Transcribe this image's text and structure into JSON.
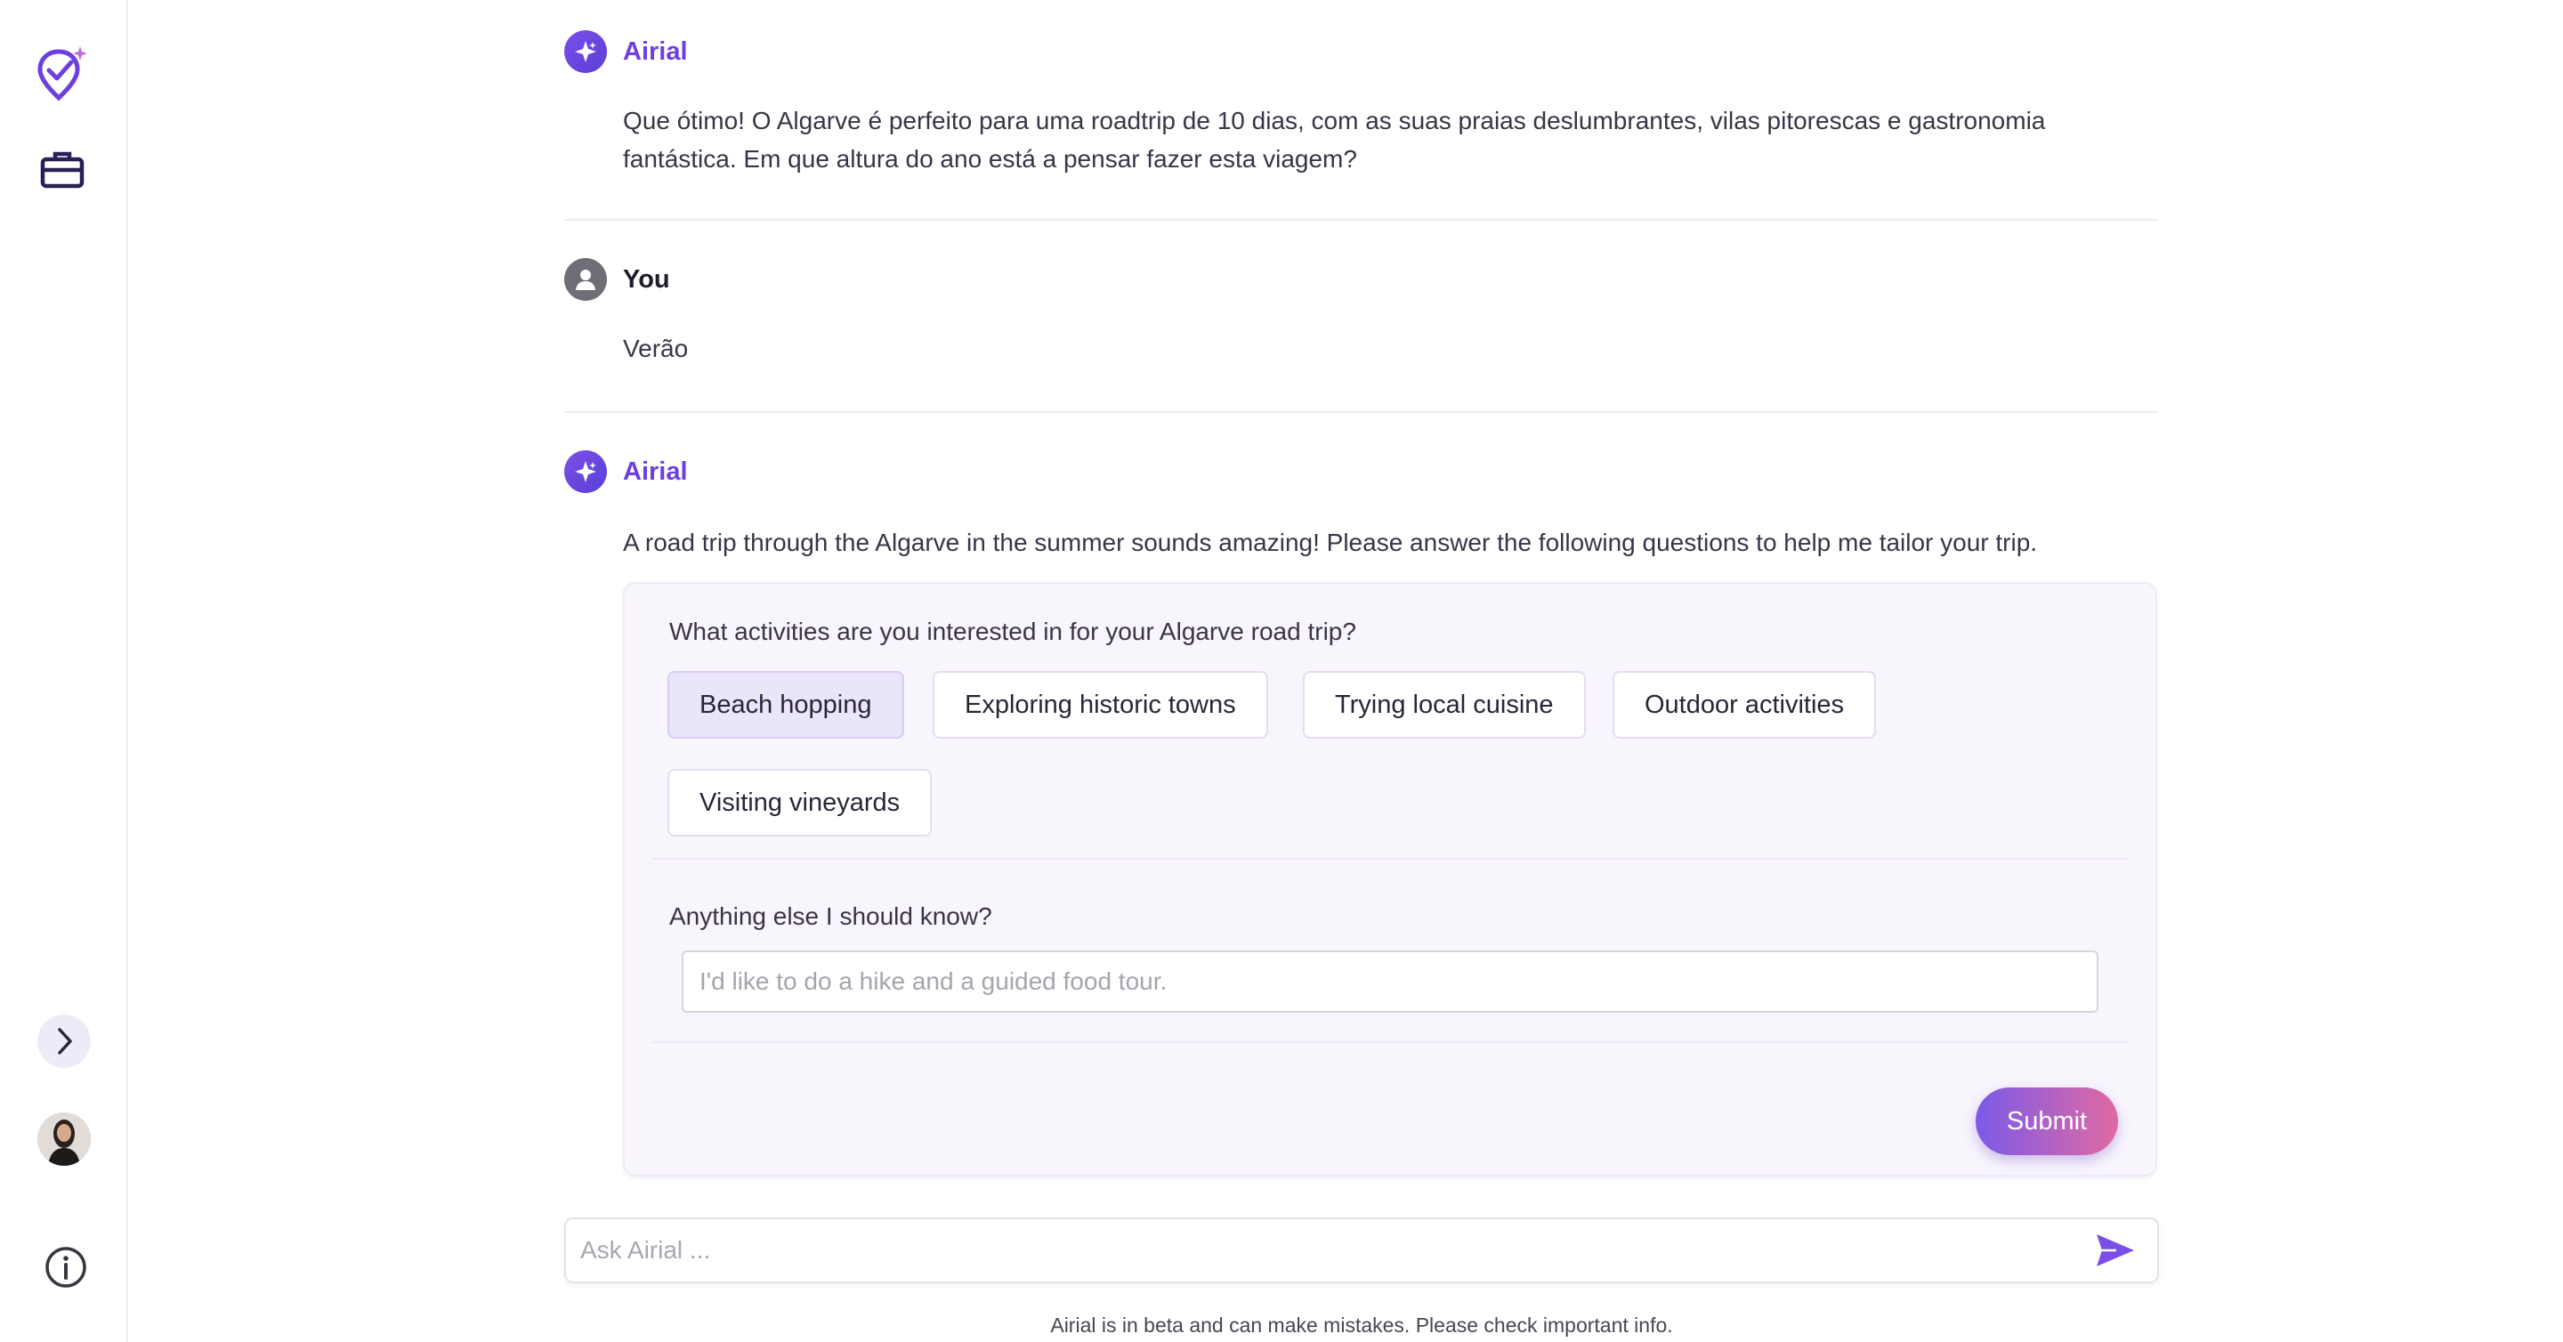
{
  "messages": [
    {
      "sender": "Airial",
      "text": "Que ótimo! O Algarve é perfeito para uma roadtrip de 10 dias, com as suas praias deslumbrantes, vilas pitorescas e gastronomia fantástica. Em que altura do ano está a pensar fazer esta viagem?"
    },
    {
      "sender": "You",
      "text": "Verão"
    },
    {
      "sender": "Airial",
      "text": "A road trip through the Algarve in the summer sounds amazing! Please answer the following questions to help me tailor your trip."
    }
  ],
  "form": {
    "activities_question": "What activities are you interested in for your Algarve road trip?",
    "activities": [
      {
        "label": "Beach hopping",
        "selected": true
      },
      {
        "label": "Exploring historic towns",
        "selected": false
      },
      {
        "label": "Trying local cuisine",
        "selected": false
      },
      {
        "label": "Outdoor activities",
        "selected": false
      },
      {
        "label": "Visiting vineyards",
        "selected": false
      }
    ],
    "extra_question": "Anything else I should know?",
    "extra_placeholder": "I'd like to do a hike and a guided food tour.",
    "submit_label": "Submit"
  },
  "composer": {
    "placeholder": "Ask Airial ...",
    "disclaimer": "Airial is in beta and can make mistakes. Please check important info."
  },
  "sidebar": {
    "icons": [
      "logo-icon",
      "briefcase-icon",
      "chevron-right-icon",
      "avatar",
      "info-icon"
    ]
  },
  "colors": {
    "accent": "#6d3fe0",
    "chip_selected_bg": "#ebe5fb",
    "card_bg": "#f8f5fd"
  }
}
